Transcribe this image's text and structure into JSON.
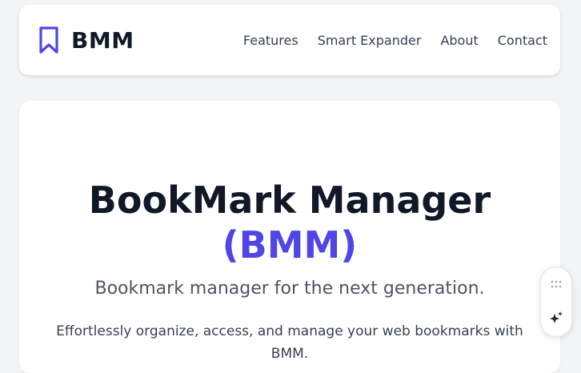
{
  "brand": {
    "name": "BMM",
    "icon": "bookmark-icon",
    "color": "#4f46e5"
  },
  "nav": {
    "items": [
      {
        "label": "Features"
      },
      {
        "label": "Smart Expander"
      },
      {
        "label": "About"
      },
      {
        "label": "Contact"
      }
    ]
  },
  "hero": {
    "title": "BookMark Manager",
    "title_accent": "(BMM)",
    "tagline": "Bookmark manager for the next generation.",
    "description": "Effortlessly organize, access, and manage your web bookmarks with BMM."
  },
  "widget": {
    "handle_icon": "drag-dots-icon",
    "action_icon": "sparkle-icon"
  },
  "colors": {
    "accent": "#4f46e5",
    "heading": "#111827",
    "body_text": "#374151",
    "background": "#f3f4f6"
  }
}
